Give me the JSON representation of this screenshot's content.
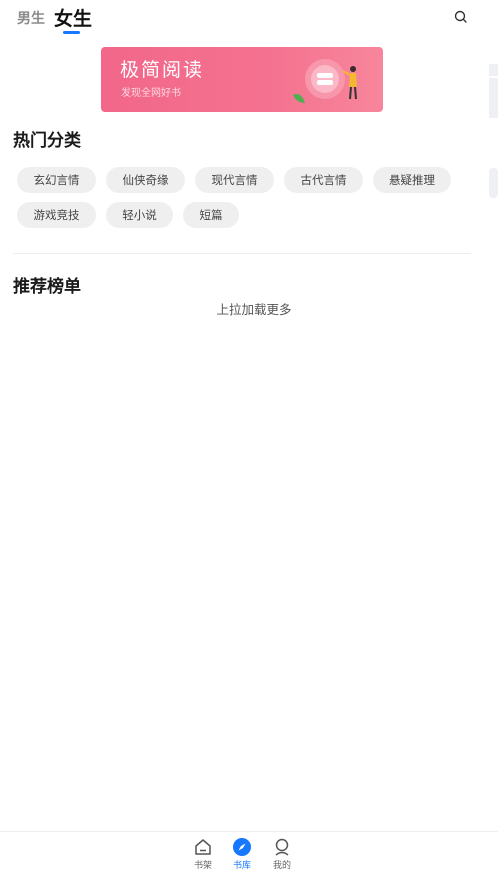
{
  "header": {
    "tabs": [
      "男生",
      "女生"
    ],
    "active_tab": "女生"
  },
  "banner": {
    "title": "极简阅读",
    "subtitle": "发现全网好书"
  },
  "hot_categories": {
    "title": "热门分类",
    "items": [
      "玄幻言情",
      "仙侠奇缘",
      "现代言情",
      "古代言情",
      "悬疑推理",
      "游戏竞技",
      "轻小说",
      "短篇"
    ]
  },
  "recommend": {
    "title": "推荐榜单",
    "load_more": "上拉加载更多"
  },
  "bottom_nav": {
    "items": [
      {
        "label": "书架",
        "icon": "bookshelf-icon"
      },
      {
        "label": "书库",
        "icon": "compass-icon"
      },
      {
        "label": "我的",
        "icon": "user-icon"
      }
    ],
    "active": "书库"
  },
  "colors": {
    "accent": "#1677ff",
    "banner": "#f2678a",
    "chip_bg": "#efefef"
  }
}
